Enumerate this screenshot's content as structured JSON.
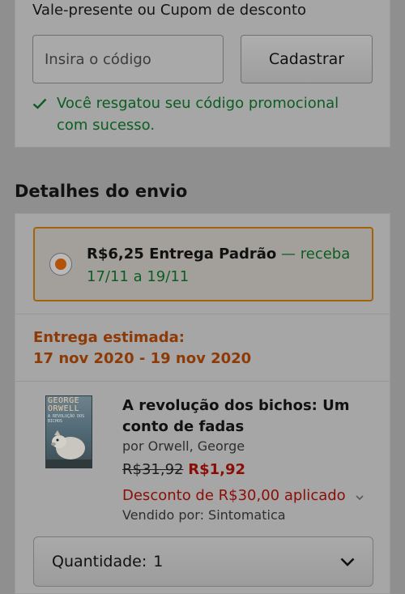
{
  "coupon": {
    "title": "Vale-presente ou Cupom de desconto",
    "input_placeholder": "Insira o código",
    "input_value": "",
    "register_label": "Cadastrar",
    "success_message": "Você resgatou seu código promocional com sucesso."
  },
  "shipping": {
    "section_title": "Detalhes do envio",
    "option": {
      "price": "R$6,25 Entrega Padrão",
      "receive": " — receba 17/11 a 19/11"
    },
    "estimated_label": "Entrega estimada:",
    "estimated_range": "17 nov 2020 - 19 nov 2020"
  },
  "item": {
    "cover_author_line1": "GEORGE",
    "cover_author_line2": "ORWELL",
    "cover_title": "A REVOLUÇÃO DOS BICHOS",
    "title": "A revolução dos bichos: Um conto de fadas",
    "author": "por Orwell, George",
    "old_price": "R$31,92",
    "new_price": "R$1,92",
    "discount": "Desconto de R$30,00 aplicado",
    "seller": "Vendido por: Sintomatica",
    "quantity_label": "Quantidade:",
    "quantity_value": "1"
  },
  "colors": {
    "success_green": "#0b5d22",
    "accent_orange": "#a4630b",
    "price_red": "#8a0e06"
  },
  "icons": [
    "check-icon",
    "chevron-down-icon"
  ]
}
